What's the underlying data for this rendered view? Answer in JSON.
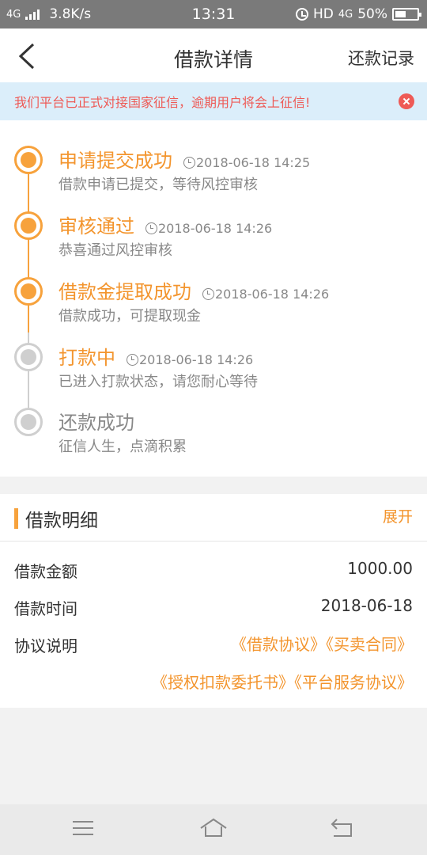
{
  "status_bar": {
    "network": "4G",
    "speed": "3.8K/s",
    "time": "13:31",
    "hd": "HD",
    "net_right": "4G",
    "battery": "50%",
    "battery_level": 0.5
  },
  "header": {
    "title": "借款详情",
    "records": "还款记录"
  },
  "notice": {
    "text": "我们平台已正式对接国家征信，逾期用户将会上征信!"
  },
  "timeline": [
    {
      "title": "申请提交成功",
      "time": "2018-06-18 14:25",
      "desc": "借款申请已提交，等待风控审核",
      "done": true
    },
    {
      "title": "审核通过",
      "time": "2018-06-18 14:26",
      "desc": "恭喜通过风控审核",
      "done": true
    },
    {
      "title": "借款金提取成功",
      "time": "2018-06-18 14:26",
      "desc": "借款成功，可提取现金",
      "done": true
    },
    {
      "title": "打款中",
      "time": "2018-06-18 14:26",
      "desc": "已进入打款状态，请您耐心等待",
      "done": false
    },
    {
      "title": "还款成功",
      "time": "",
      "desc": "征信人生，点滴积累",
      "done": false
    }
  ],
  "detail": {
    "title": "借款明细",
    "expand": "展开",
    "amount_label": "借款金额",
    "amount": "1000.00",
    "time_label": "借款时间",
    "time": "2018-06-18",
    "agreement_label": "协议说明",
    "agreements": [
      "《借款协议》",
      "《买卖合同》",
      "《授权扣款委托书》",
      "《平台服务协议》"
    ]
  },
  "colors": {
    "accent": "#f7a23c",
    "accent_text": "#f3952e",
    "notice_text": "#ee5a56",
    "notice_bg": "#dbeefa",
    "inactive": "#cfcfcf"
  }
}
